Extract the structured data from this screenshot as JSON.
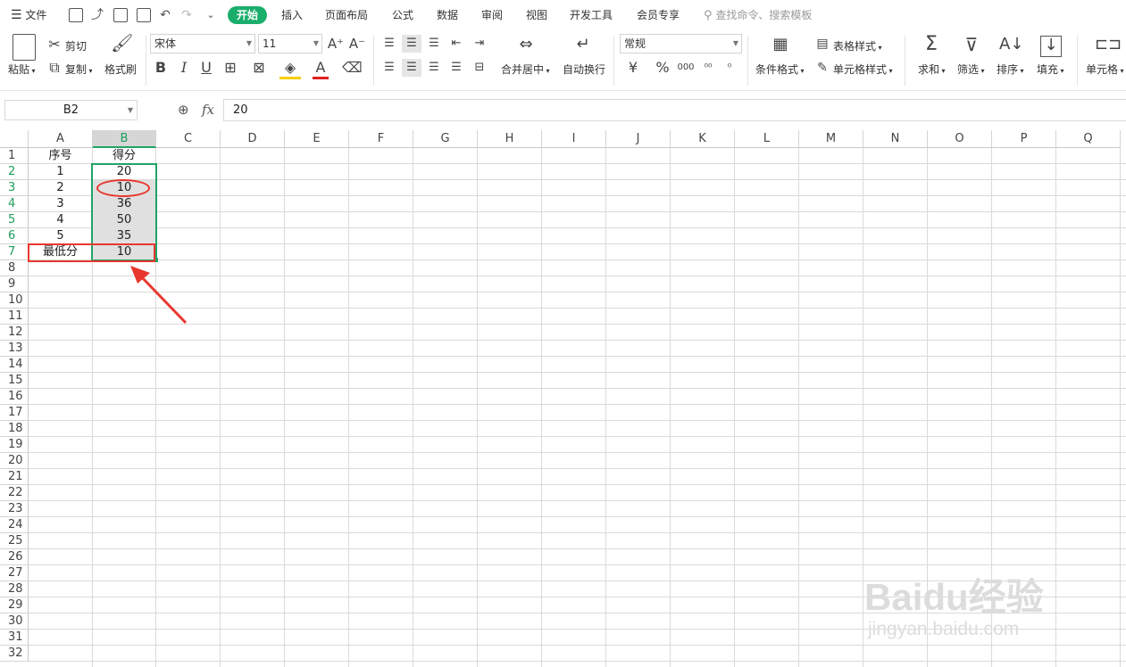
{
  "menubar": {
    "file_label": "文件",
    "tabs": [
      {
        "label": "开始",
        "active": true
      },
      {
        "label": "插入"
      },
      {
        "label": "页面布局"
      },
      {
        "label": "公式"
      },
      {
        "label": "数据"
      },
      {
        "label": "审阅"
      },
      {
        "label": "视图"
      },
      {
        "label": "开发工具"
      },
      {
        "label": "会员专享"
      }
    ],
    "search_placeholder": "查找命令、搜索模板",
    "accent_color": "#1aae6c"
  },
  "ribbon": {
    "paste": "粘贴",
    "cut": "剪切",
    "copy": "复制",
    "format_painter": "格式刷",
    "font_name": "宋体",
    "font_size": "11",
    "bold": "B",
    "italic": "I",
    "underline": "U",
    "merge_center": "合并居中",
    "wrap_text": "自动换行",
    "number_format": "常规",
    "currency": "¥",
    "percent": "%",
    "thousands": "000",
    "conditional_format": "条件格式",
    "table_style": "表格样式",
    "cell_style": "单元格样式",
    "sum": "求和",
    "filter": "筛选",
    "sort": "排序",
    "fill": "填充",
    "cell": "单元格"
  },
  "formula_bar": {
    "name_box": "B2",
    "fx_label": "fx",
    "value": "20"
  },
  "sheet": {
    "columns": [
      "A",
      "B",
      "C",
      "D",
      "E",
      "F",
      "G",
      "H",
      "I",
      "J",
      "K",
      "L",
      "M",
      "N",
      "O",
      "P",
      "Q"
    ],
    "row_count": 32,
    "header_row": [
      "序号",
      "得分"
    ],
    "rows": [
      [
        "1",
        "20"
      ],
      [
        "2",
        "10"
      ],
      [
        "3",
        "36"
      ],
      [
        "4",
        "50"
      ],
      [
        "5",
        "35"
      ]
    ],
    "summary_row": [
      "最低分",
      "10"
    ],
    "selection": "B2:B7",
    "selection_color": "#21a366",
    "annotation_color": "#e8372f"
  },
  "watermark": {
    "brand": "Baidu经验",
    "url": "jingyan.baidu.com"
  }
}
